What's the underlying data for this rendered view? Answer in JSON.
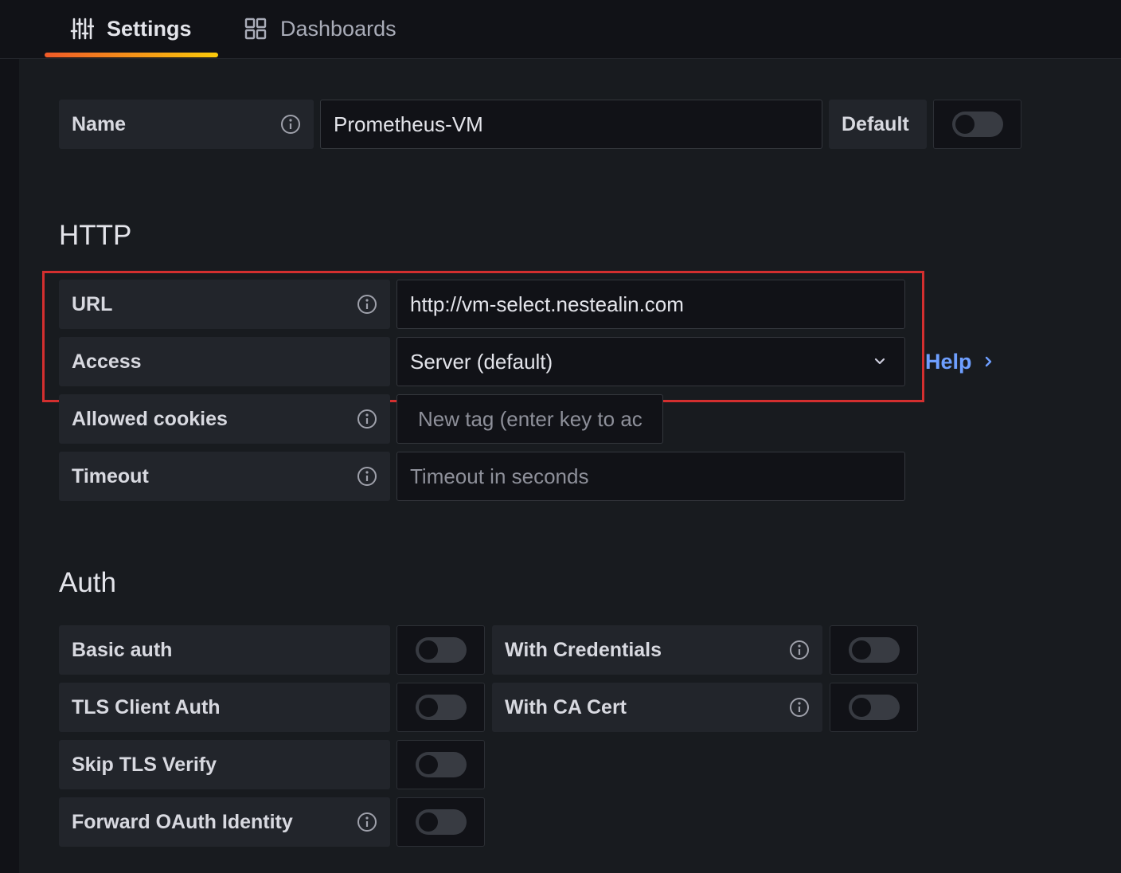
{
  "tabs": [
    {
      "label": "Settings",
      "icon": "sliders-icon",
      "active": true
    },
    {
      "label": "Dashboards",
      "icon": "grid-icon",
      "active": false
    }
  ],
  "colors": {
    "accent_start": "#f05a28",
    "accent_end": "#fbca0a",
    "highlight": "#d32f2f",
    "link": "#6e9fff"
  },
  "general": {
    "name_label": "Name",
    "name_value": "Prometheus-VM",
    "default_label": "Default",
    "default_enabled": false
  },
  "http": {
    "title": "HTTP",
    "url_label": "URL",
    "url_value": "http://vm-select.nestealin.com",
    "access_label": "Access",
    "access_value": "Server (default)",
    "help_label": "Help",
    "cookies_label": "Allowed cookies",
    "cookies_placeholder": "New tag (enter key to ac",
    "timeout_label": "Timeout",
    "timeout_placeholder": "Timeout in seconds"
  },
  "auth": {
    "title": "Auth",
    "basic_auth_label": "Basic auth",
    "basic_auth_enabled": false,
    "with_credentials_label": "With Credentials",
    "with_credentials_enabled": false,
    "tls_client_auth_label": "TLS Client Auth",
    "tls_client_auth_enabled": false,
    "with_ca_cert_label": "With CA Cert",
    "with_ca_cert_enabled": false,
    "skip_tls_label": "Skip TLS Verify",
    "skip_tls_enabled": false,
    "forward_oauth_label": "Forward OAuth Identity",
    "forward_oauth_enabled": false
  }
}
